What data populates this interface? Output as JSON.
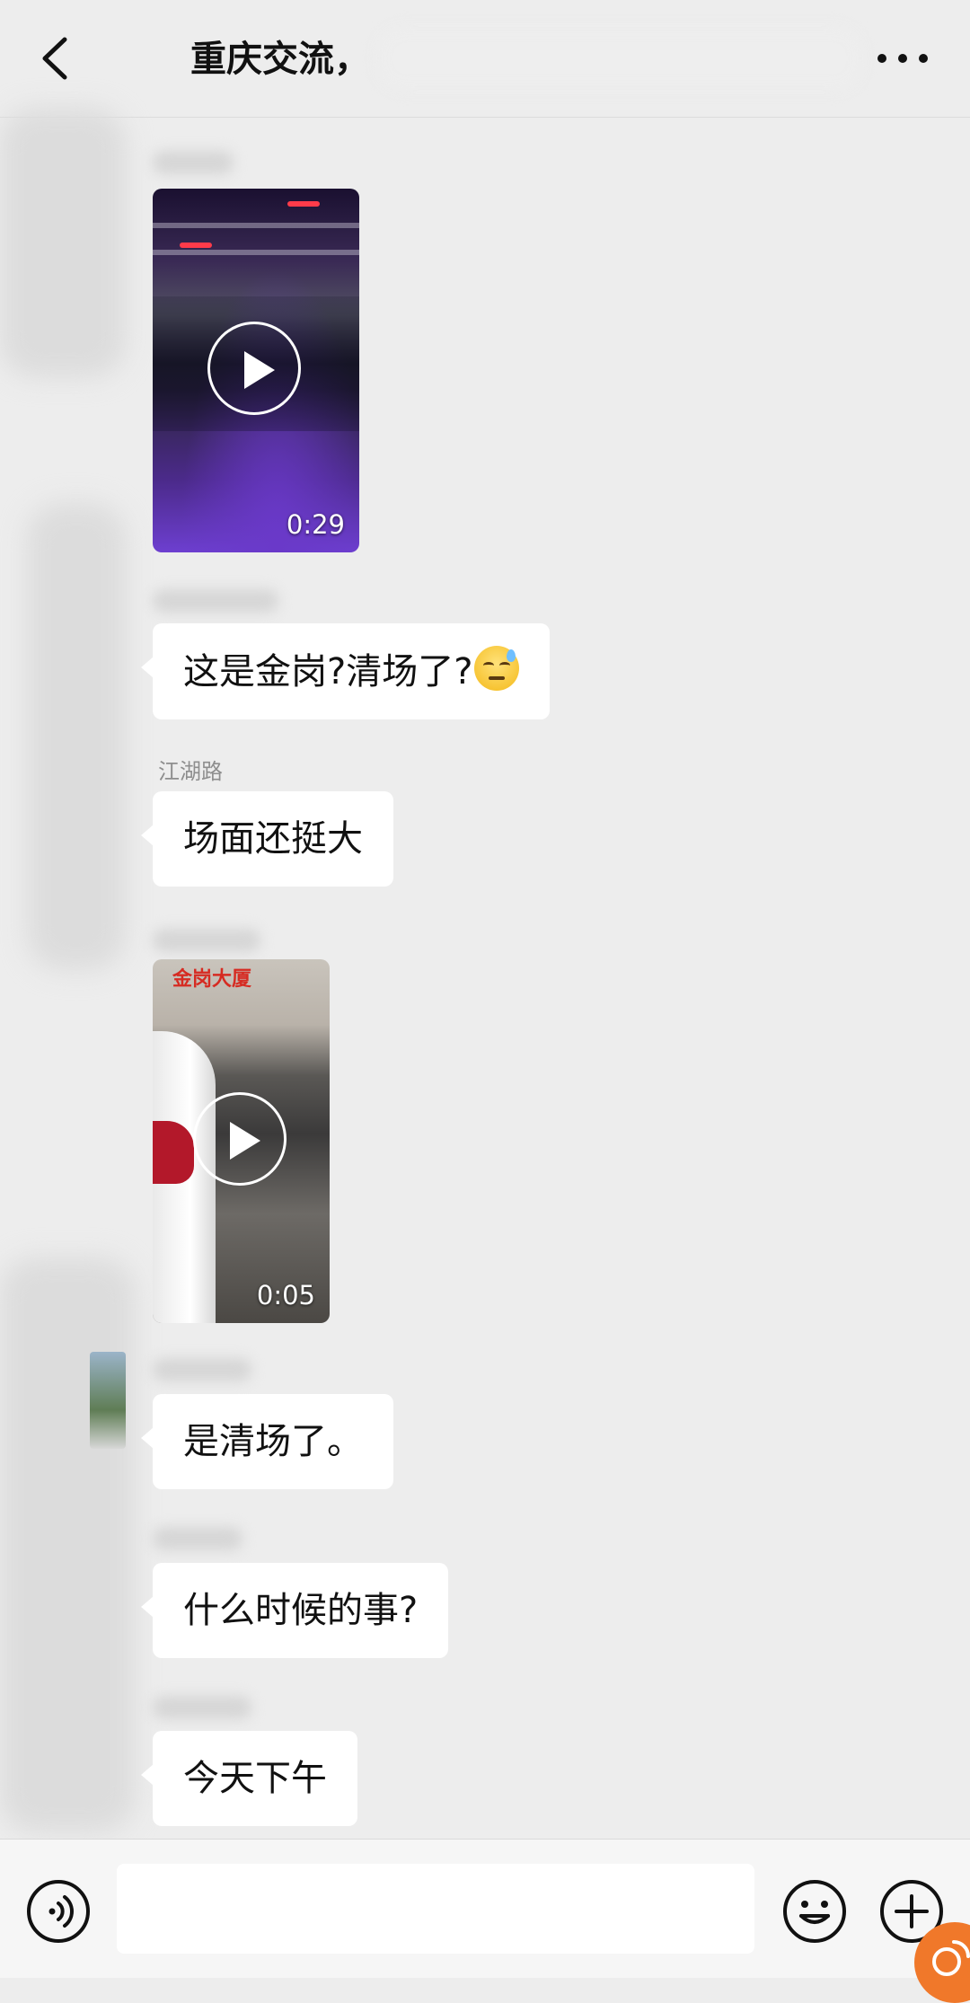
{
  "header": {
    "title": "重庆交流，",
    "icons": {
      "back": "chevron-left-icon",
      "more": "ellipsis-icon"
    }
  },
  "messages": [
    {
      "type": "video",
      "duration": "0:29"
    },
    {
      "type": "text",
      "text": "这是金岗?清场了?",
      "emoji": "sweat-smile-emoji"
    },
    {
      "type": "text",
      "sender": "江湖路",
      "text": "场面还挺大"
    },
    {
      "type": "video",
      "duration": "0:05",
      "sign_text": "金岗大厦"
    },
    {
      "type": "text",
      "text": "是清场了。"
    },
    {
      "type": "text",
      "text": "什么时候的事?"
    },
    {
      "type": "text",
      "text": "今天下午"
    }
  ],
  "input_bar": {
    "value": "",
    "icons": {
      "voice": "voice-icon",
      "emoji": "emoji-face-icon",
      "more": "plus-circle-icon"
    }
  },
  "colors": {
    "background": "#ededed",
    "bubble": "#ffffff",
    "accent": "#f0782a"
  }
}
